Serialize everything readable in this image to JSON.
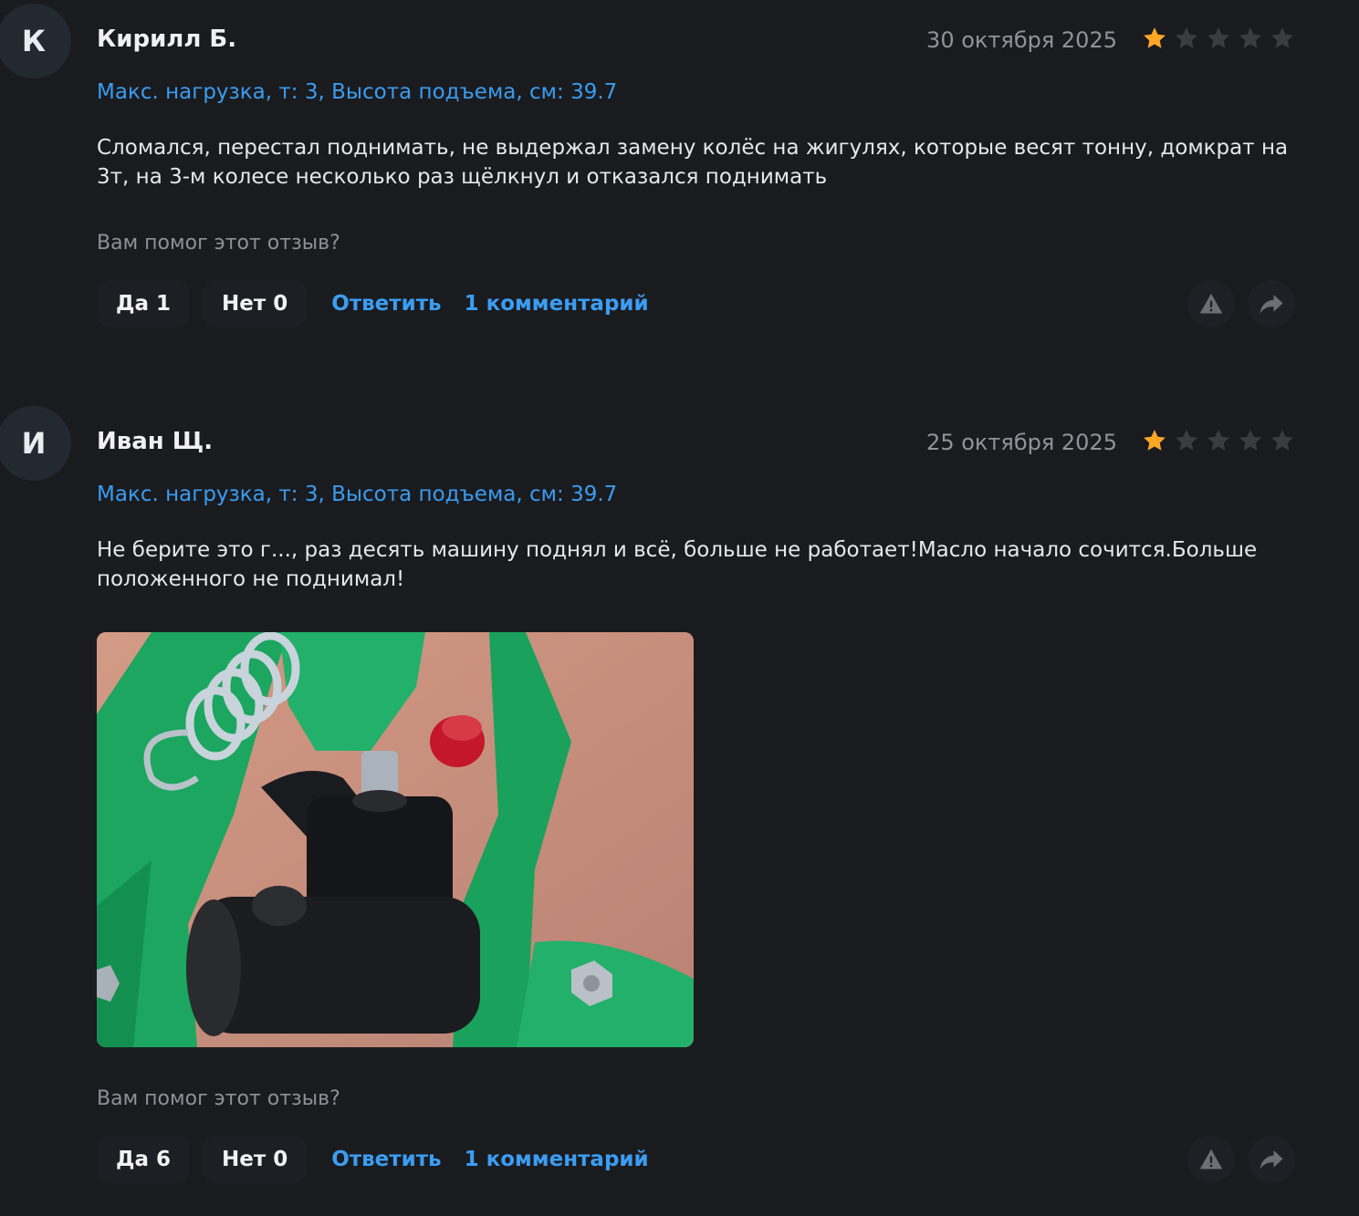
{
  "reviews": [
    {
      "avatar_letter": "К",
      "author": "Кирилл Б.",
      "date": "30 октября 2025",
      "rating": 1,
      "variant": "Макс. нагрузка, т: 3, Высота подъема, см: 39.7",
      "text": "Сломался, перестал поднимать, не выдержал замену колёс на жигулях, которые весят тонну, домкрат на 3т, на 3-м колесе несколько раз щёлкнул и отказался поднимать",
      "helpful_question": "Вам помог этот отзыв?",
      "yes_label": "Да 1",
      "no_label": "Нет 0",
      "reply_label": "Ответить",
      "comments_label": "1 комментарий"
    },
    {
      "avatar_letter": "И",
      "author": "Иван Щ.",
      "date": "25 октября 2025",
      "rating": 1,
      "variant": "Макс. нагрузка, т: 3, Высота подъема, см: 39.7",
      "text": "Не берите это г..., раз десять машину поднял и всё, больше не работает!Масло начало сочится.Больше положенного не поднимал!",
      "helpful_question": "Вам помог этот отзыв?",
      "yes_label": "Да 6",
      "no_label": "Нет 0",
      "reply_label": "Ответить",
      "comments_label": "1 комментарий"
    }
  ],
  "colors": {
    "star_active": "#ffa826",
    "star_inactive": "#3a3c42",
    "link": "#3a9cf0"
  }
}
